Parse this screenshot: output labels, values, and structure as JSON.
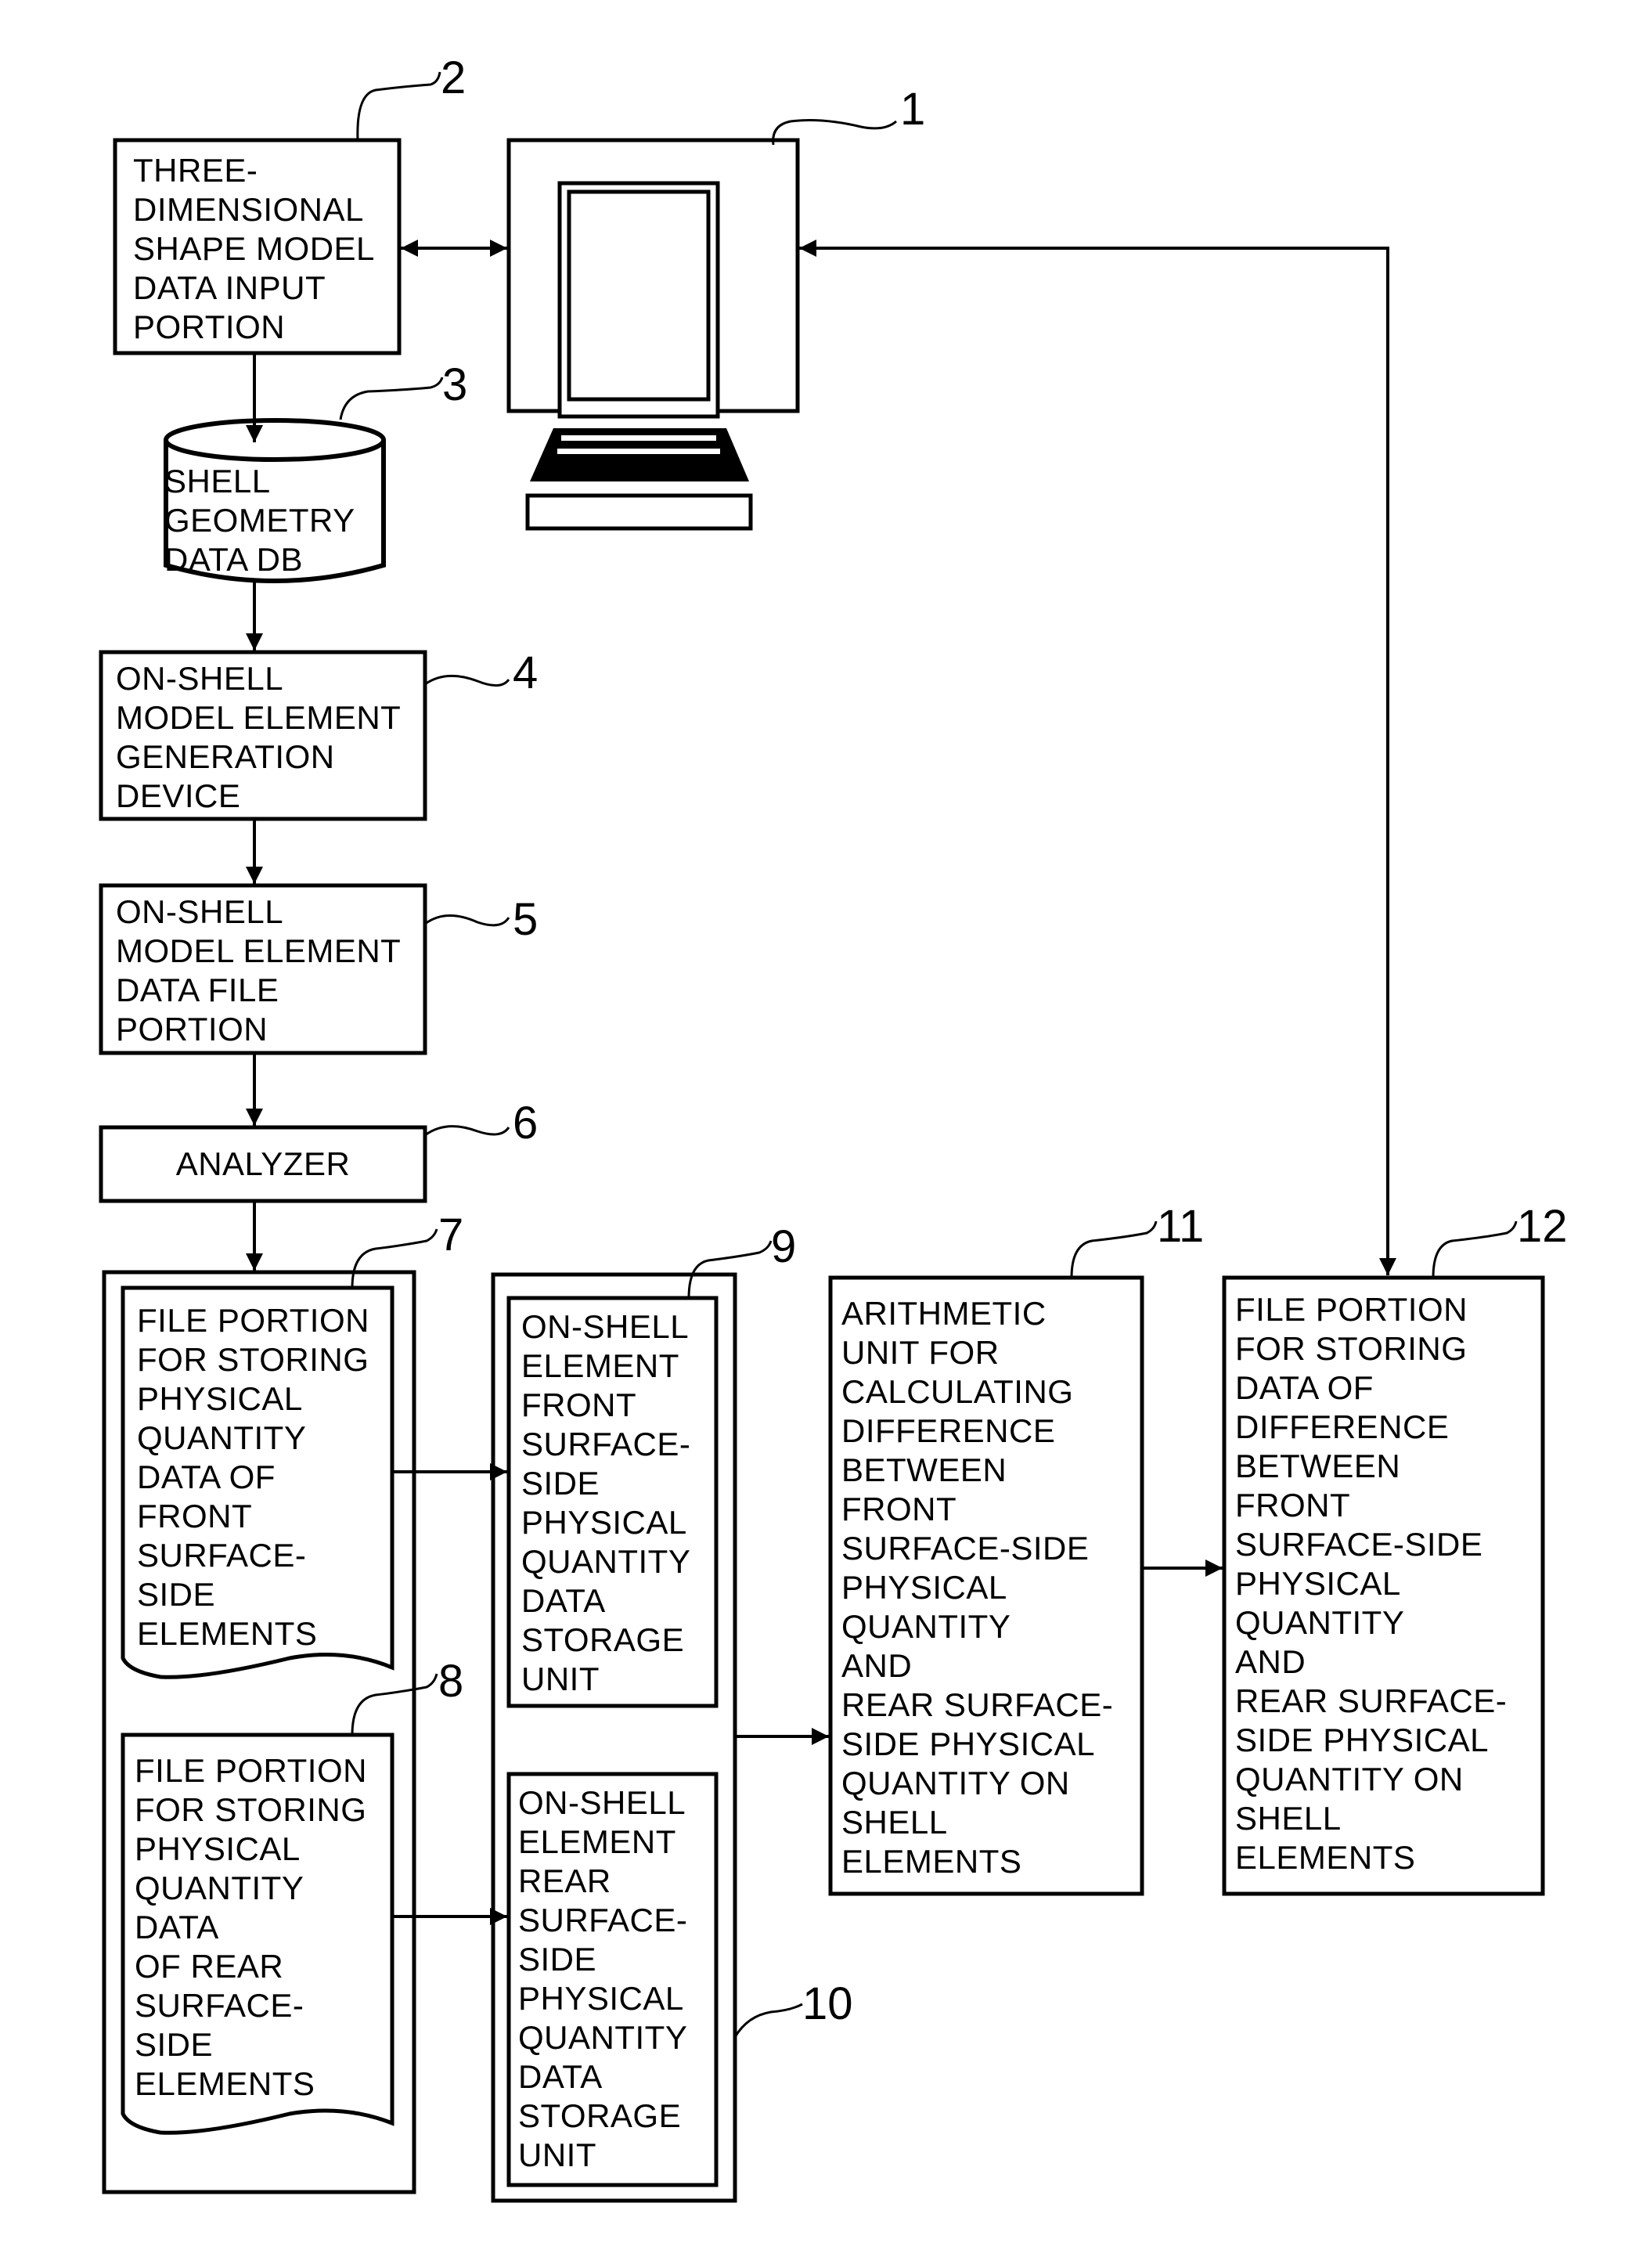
{
  "figure": {
    "components": [
      {
        "ref": "1",
        "name": "computer",
        "icon": "laptop-computer-icon",
        "lines": []
      },
      {
        "ref": "2",
        "name": "three-dimensional-shape-model-data-input-portion",
        "lines": [
          "THREE-",
          "DIMENSIONAL",
          "SHAPE MODEL",
          "DATA INPUT",
          "PORTION"
        ]
      },
      {
        "ref": "3",
        "name": "shell-geometry-data-db",
        "lines": [
          "SHELL",
          "GEOMETRY",
          "DATA DB"
        ]
      },
      {
        "ref": "4",
        "name": "on-shell-model-element-generation-device",
        "lines": [
          "ON-SHELL",
          "MODEL ELEMENT",
          "GENERATION",
          "DEVICE"
        ]
      },
      {
        "ref": "5",
        "name": "on-shell-model-element-data-file-portion",
        "lines": [
          "ON-SHELL",
          "MODEL ELEMENT",
          "DATA FILE",
          "PORTION"
        ]
      },
      {
        "ref": "6",
        "name": "analyzer",
        "lines": [
          "ANALYZER"
        ]
      },
      {
        "ref": "7",
        "name": "front-surface-elements-file-portion",
        "lines": [
          "FILE PORTION",
          "FOR STORING",
          "PHYSICAL",
          "QUANTITY",
          "DATA OF",
          "FRONT",
          "SURFACE-",
          "SIDE",
          "ELEMENTS"
        ]
      },
      {
        "ref": "8",
        "name": "rear-surface-elements-file-portion",
        "lines": [
          "FILE PORTION",
          "FOR STORING",
          "PHYSICAL",
          "QUANTITY",
          "DATA",
          "OF REAR",
          "SURFACE-",
          "SIDE",
          "ELEMENTS"
        ]
      },
      {
        "ref": "9",
        "name": "front-surface-physical-quantity-storage-unit",
        "lines": [
          "ON-SHELL",
          "ELEMENT",
          "FRONT",
          "SURFACE-",
          "SIDE",
          "PHYSICAL",
          "QUANTITY",
          "DATA",
          "STORAGE",
          "UNIT"
        ]
      },
      {
        "ref": "10",
        "name": "rear-surface-physical-quantity-storage-unit",
        "lines": [
          "ON-SHELL",
          "ELEMENT",
          "REAR",
          "SURFACE-",
          "SIDE",
          "PHYSICAL",
          "QUANTITY",
          "DATA",
          "STORAGE",
          "UNIT"
        ]
      },
      {
        "ref": "11",
        "name": "arithmetic-unit",
        "lines": [
          "ARITHMETIC",
          "UNIT FOR",
          "CALCULATING",
          "DIFFERENCE",
          "BETWEEN",
          "FRONT",
          "SURFACE-SIDE",
          "PHYSICAL",
          "QUANTITY",
          "AND",
          "REAR SURFACE-",
          "SIDE PHYSICAL",
          "QUANTITY ON",
          "SHELL",
          "ELEMENTS"
        ]
      },
      {
        "ref": "12",
        "name": "difference-data-file-portion",
        "lines": [
          "FILE PORTION",
          "FOR STORING",
          "DATA OF",
          "DIFFERENCE",
          "BETWEEN",
          "FRONT",
          "SURFACE-SIDE",
          "PHYSICAL",
          "QUANTITY",
          "AND",
          "REAR SURFACE-",
          "SIDE PHYSICAL",
          "QUANTITY ON",
          "SHELL",
          "ELEMENTS"
        ]
      }
    ],
    "connections": [
      {
        "from": "2",
        "to": "1",
        "type": "bidirectional"
      },
      {
        "from": "12",
        "to": "1",
        "type": "bidirectional"
      },
      {
        "from": "2",
        "to": "3",
        "type": "arrow"
      },
      {
        "from": "3",
        "to": "4",
        "type": "arrow"
      },
      {
        "from": "4",
        "to": "5",
        "type": "arrow"
      },
      {
        "from": "5",
        "to": "6",
        "type": "arrow"
      },
      {
        "from": "6",
        "to": "7",
        "type": "arrow"
      },
      {
        "from": "7",
        "to": "9",
        "type": "arrow"
      },
      {
        "from": "8",
        "to": "10",
        "type": "arrow"
      },
      {
        "from": "9-10",
        "to": "11",
        "type": "arrow"
      },
      {
        "from": "11",
        "to": "12",
        "type": "arrow"
      }
    ]
  }
}
